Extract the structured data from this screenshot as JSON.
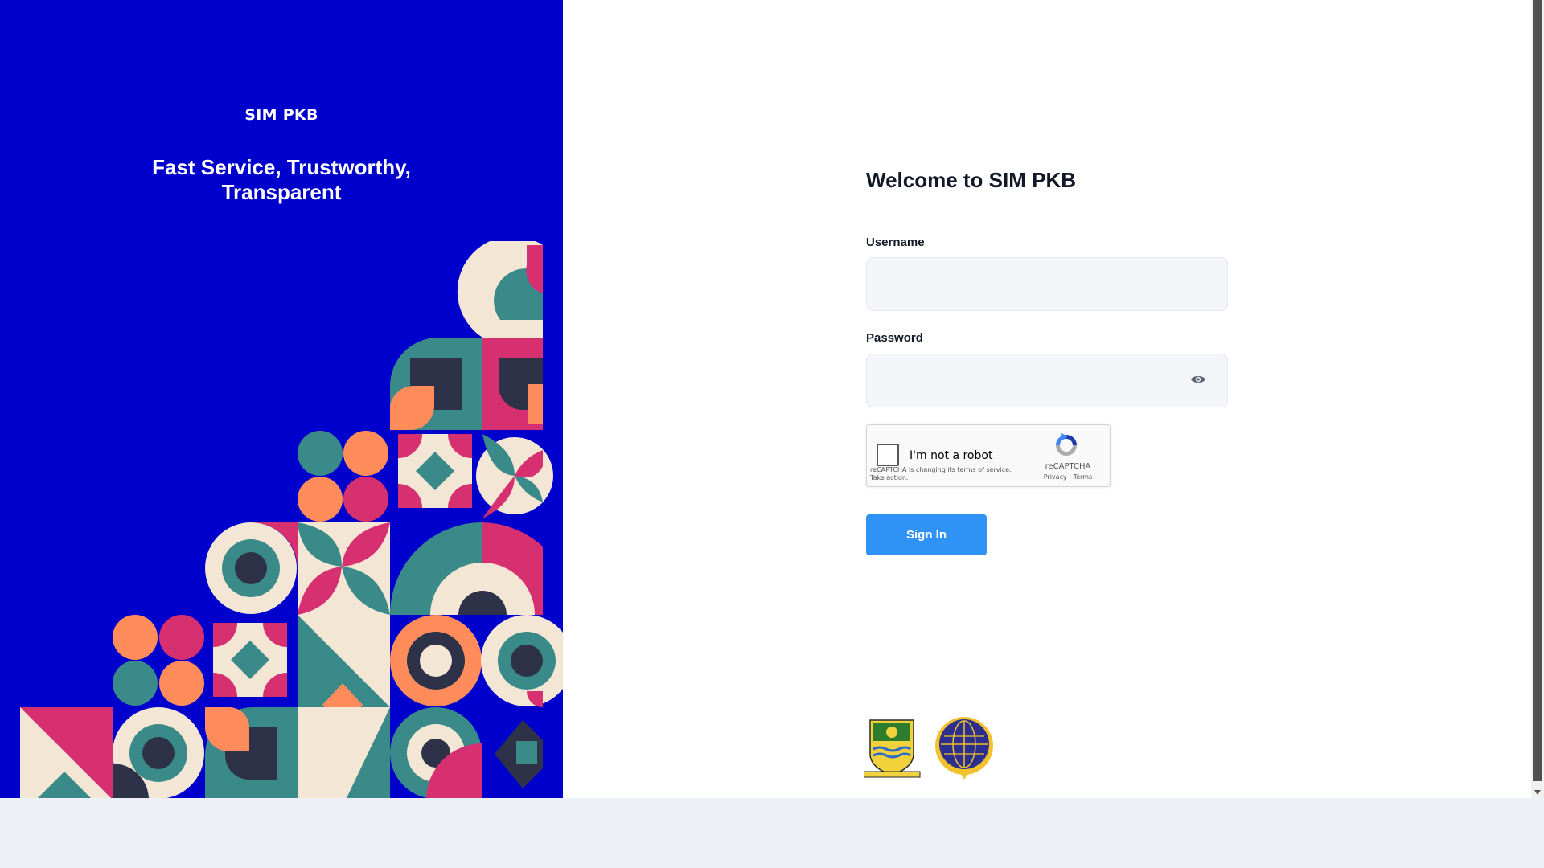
{
  "brand": {
    "app_name": "SIM PKB",
    "tagline": "Fast Service, Trustworthy, Transparent"
  },
  "login": {
    "welcome_title": "Welcome to SIM PKB",
    "username_label": "Username",
    "username_value": "",
    "password_label": "Password",
    "password_value": "",
    "sign_in_label": "Sign In"
  },
  "recaptcha": {
    "checkbox_label": "I'm not a robot",
    "notice_line": "reCAPTCHA is changing its terms of service.",
    "notice_action": "Take action.",
    "brand": "reCAPTCHA",
    "links": "Privacy - Terms"
  },
  "colors": {
    "left_panel": "#0000cc",
    "button": "#2f93f5",
    "teal": "#3a8a8a",
    "pink": "#d63070",
    "orange": "#ff8c5a",
    "cream": "#f3e6d4",
    "navy": "#2e3248"
  },
  "icons": {
    "password_toggle": "eye-icon",
    "captcha": "recaptcha-logo",
    "logo_1": "regional-emblem-logo",
    "logo_2": "transport-ministry-logo"
  }
}
